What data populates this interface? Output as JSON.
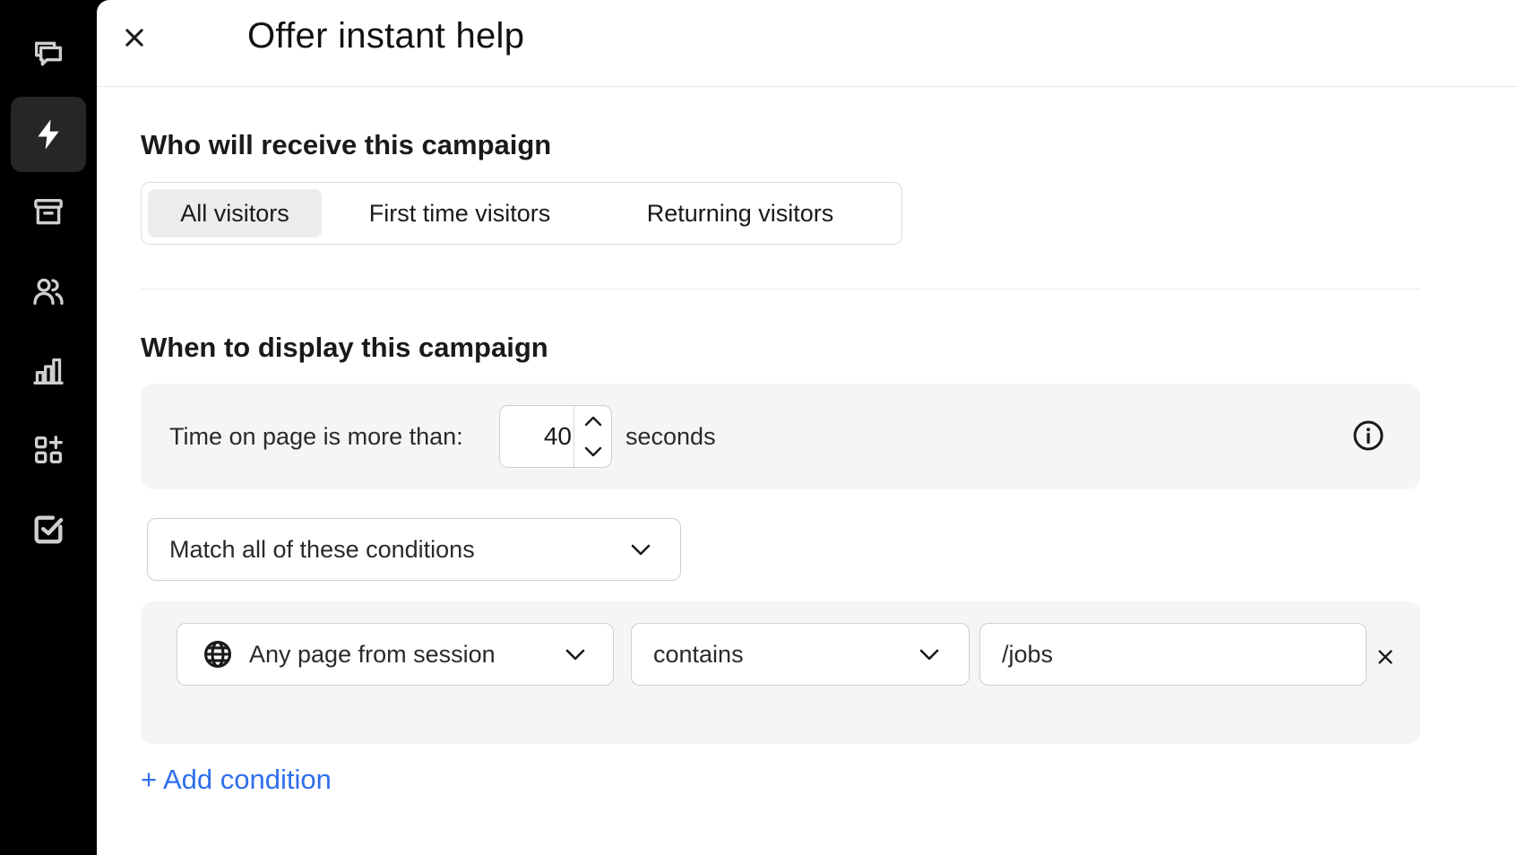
{
  "sidebar": {
    "items": [
      {
        "icon": "chat-icon",
        "active": false
      },
      {
        "icon": "lightning-icon",
        "active": true
      },
      {
        "icon": "archive-icon",
        "active": false
      },
      {
        "icon": "users-icon",
        "active": false
      },
      {
        "icon": "bar-chart-icon",
        "active": false
      },
      {
        "icon": "apps-add-icon",
        "active": false
      },
      {
        "icon": "checkbox-icon",
        "active": false
      }
    ]
  },
  "header": {
    "title": "Offer instant help",
    "close_icon": "close-icon"
  },
  "audience": {
    "heading": "Who will receive this campaign",
    "options": [
      {
        "label": "All visitors",
        "selected": true
      },
      {
        "label": "First time visitors",
        "selected": false
      },
      {
        "label": "Returning visitors",
        "selected": false
      }
    ]
  },
  "display": {
    "heading": "When to display this campaign",
    "time_label": "Time on page is more than:",
    "time_value": "40",
    "time_unit": "seconds",
    "info_icon": "info-icon"
  },
  "match": {
    "selected": "Match all of these conditions"
  },
  "condition": {
    "field": "Any page from session",
    "operator": "contains",
    "value": "/jobs",
    "field_icon": "globe-icon",
    "remove_icon": "close-icon"
  },
  "add_condition": {
    "label": "+ Add condition"
  },
  "colors": {
    "sidebar_bg": "#000000",
    "active_item_bg": "#262626",
    "link": "#2f6fec",
    "panel_bg": "#ffffff",
    "box_bg": "#f5f5f5",
    "selected_segment": "#ececec"
  }
}
